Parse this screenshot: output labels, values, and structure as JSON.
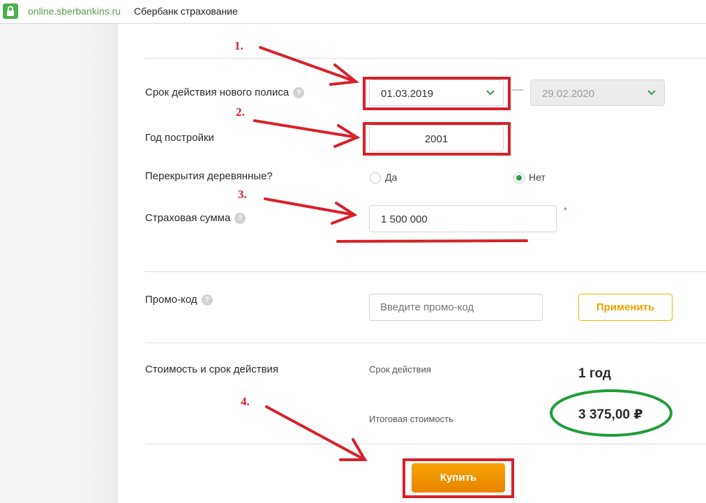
{
  "browser": {
    "domain": "online.sberbankins.ru",
    "page_title": "Сбербанк страхование"
  },
  "annotations": [
    "1.",
    "2.",
    "3.",
    "4."
  ],
  "form": {
    "policy_term": {
      "label": "Срок действия нового полиса",
      "start_date": "01.03.2019",
      "separator": "—",
      "end_date": "29.02.2020"
    },
    "build_year": {
      "label": "Год постройки",
      "value": "2001"
    },
    "wooden_floors": {
      "label": "Перекрытия деревянные?",
      "options": [
        "Да",
        "Нет"
      ],
      "selected": "Нет"
    },
    "insured_sum": {
      "label": "Страховая сумма",
      "value": "1 500 000",
      "required_mark": "*"
    },
    "promo": {
      "label": "Промо-код",
      "placeholder": "Введите промо-код",
      "apply_label": "Применить"
    },
    "cost": {
      "label": "Стоимость и срок действия",
      "term_label": "Срок действия",
      "term_value": "1 год",
      "total_label": "Итоговая стоимость",
      "total_value": "3 375,00 ₽"
    },
    "buy_label": "Купить"
  },
  "colors": {
    "annotation_red": "#d8202a",
    "highlight_green": "#1f9c3a",
    "accent_orange": "#f0a000",
    "check_green": "#2f9e44"
  }
}
